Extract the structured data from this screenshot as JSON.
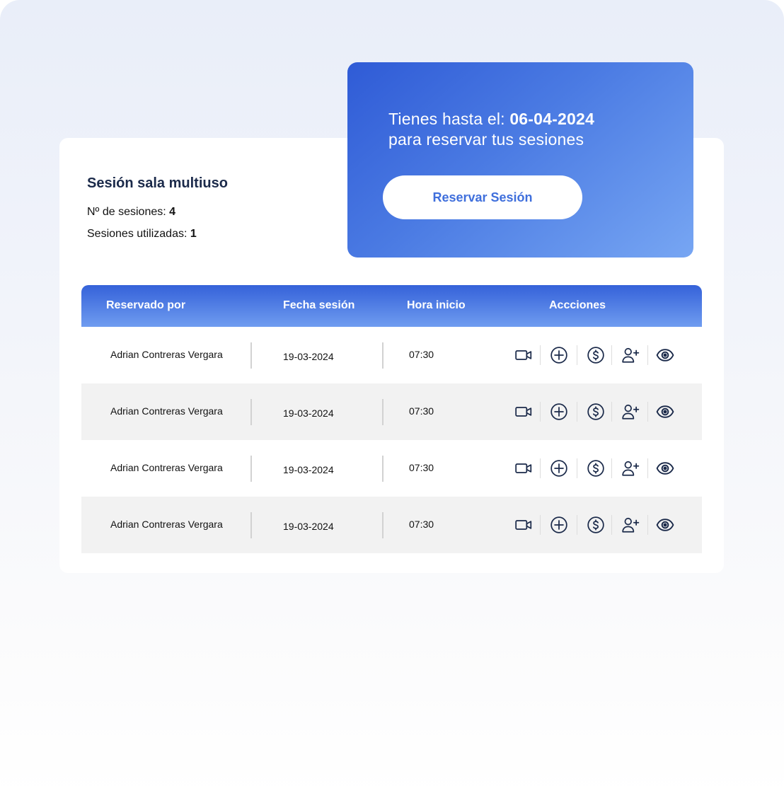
{
  "promo": {
    "line1_prefix": "Tienes hasta el: ",
    "deadline": "06-04-2024",
    "line2": "para reservar tus sesiones",
    "button_label": "Reservar Sesión"
  },
  "session": {
    "title": "Sesión sala multiuso",
    "sessions_label": "Nº de sesiones: ",
    "sessions_value": "4",
    "used_label": "Sesiones utilizadas: ",
    "used_value": "1"
  },
  "table": {
    "headers": [
      "Reservado por",
      "Fecha sesión",
      "Hora inicio",
      "Accciones"
    ],
    "rows": [
      {
        "name": "Adrian Contreras Vergara",
        "date": "19-03-2024",
        "time": "07:30"
      },
      {
        "name": "Adrian Contreras Vergara",
        "date": "19-03-2024",
        "time": "07:30"
      },
      {
        "name": "Adrian Contreras Vergara",
        "date": "19-03-2024",
        "time": "07:30"
      },
      {
        "name": "Adrian Contreras Vergara",
        "date": "19-03-2024",
        "time": "07:30"
      }
    ],
    "actions": [
      "video-icon",
      "plus-circle-icon",
      "dollar-circle-icon",
      "add-user-icon",
      "eye-icon"
    ]
  },
  "colors": {
    "accent": "#3562d9",
    "icon": "#1b2a4a",
    "title": "#1b2a4a",
    "button_text": "#3f6fdc",
    "row_alt": "#f2f2f2"
  }
}
